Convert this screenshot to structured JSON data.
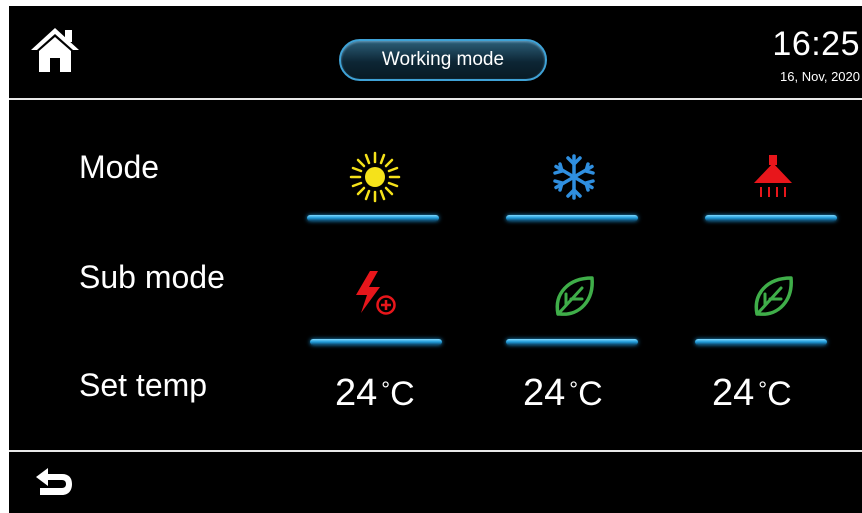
{
  "header": {
    "title": "Working mode",
    "time": "16:25",
    "date": "16, Nov, 2020",
    "home_icon": "home-icon"
  },
  "rows": {
    "mode_label": "Mode",
    "submode_label": "Sub mode",
    "settemp_label": "Set temp"
  },
  "modes": [
    {
      "icon": "sun-heating-icon",
      "color": "#f5e21a"
    },
    {
      "icon": "snowflake-cooling-icon",
      "color": "#2f8fe0"
    },
    {
      "icon": "shower-hot-water-icon",
      "color": "#e8161b"
    }
  ],
  "submodes": [
    {
      "icon": "boost-lightning-icon",
      "color": "#e8161b"
    },
    {
      "icon": "eco-leaf-icon",
      "color": "#3fae49"
    },
    {
      "icon": "eco-leaf-icon",
      "color": "#3fae49"
    }
  ],
  "temps": [
    {
      "value": "24",
      "deg": "°",
      "unit": "C"
    },
    {
      "value": "24",
      "deg": "°",
      "unit": "C"
    },
    {
      "value": "24",
      "deg": "°",
      "unit": "C"
    }
  ],
  "footer": {
    "back_icon": "back-arrow-icon"
  },
  "colors": {
    "background": "#000000",
    "accent": "#1f9ad8",
    "text": "#ffffff"
  }
}
